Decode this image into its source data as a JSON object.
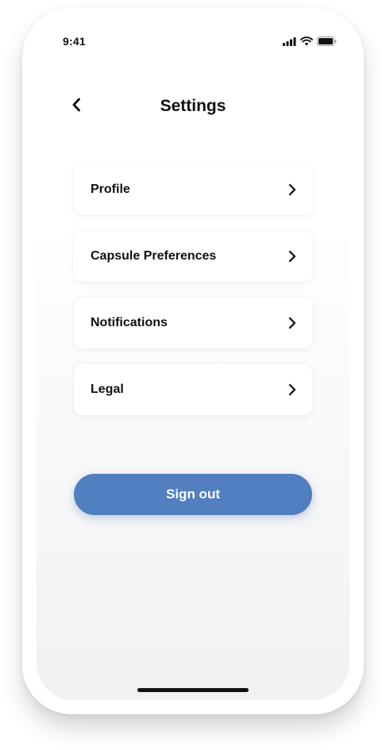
{
  "status_bar": {
    "time": "9:41",
    "icons": [
      "signal-icon",
      "wifi-icon",
      "battery-icon"
    ]
  },
  "header": {
    "back_icon": "chevron-left-icon",
    "title": "Settings"
  },
  "menu": {
    "items": [
      {
        "label": "Profile",
        "icon": "chevron-right-icon"
      },
      {
        "label": "Capsule Preferences",
        "icon": "chevron-right-icon"
      },
      {
        "label": "Notifications",
        "icon": "chevron-right-icon"
      },
      {
        "label": "Legal",
        "icon": "chevron-right-icon"
      }
    ]
  },
  "sign_out": {
    "label": "Sign out"
  },
  "colors": {
    "accent": "#527fbf",
    "text": "#111111",
    "card": "#ffffff",
    "background": "#f1f1f2"
  }
}
